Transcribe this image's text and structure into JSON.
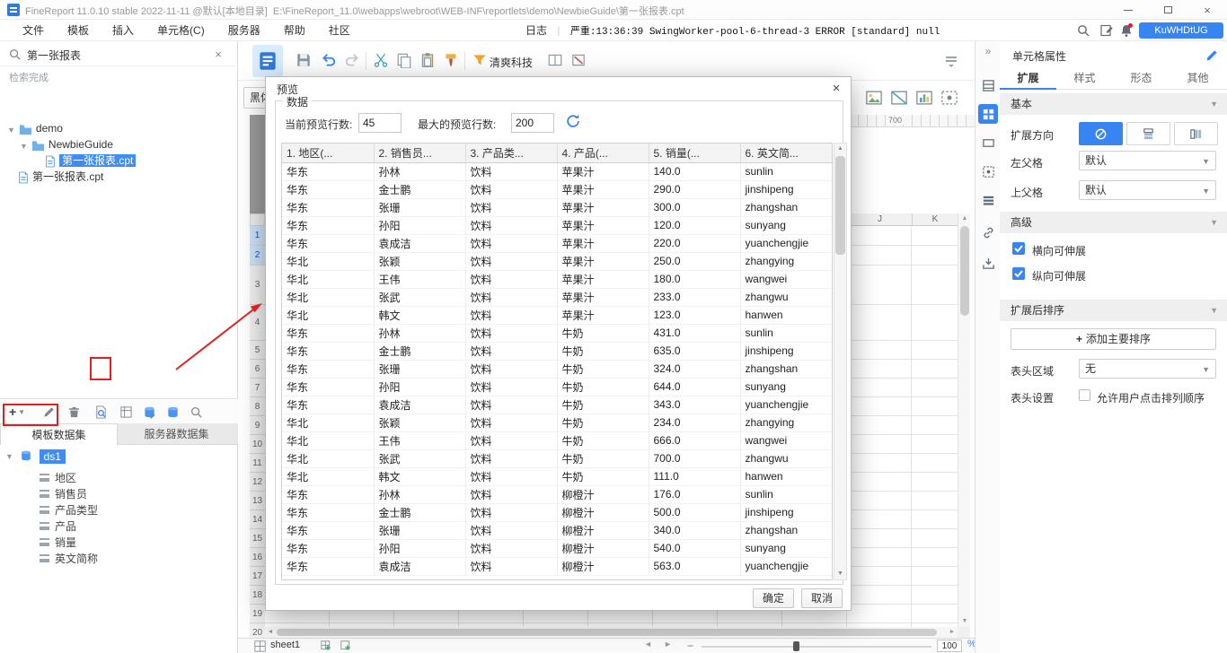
{
  "window": {
    "title": "FineReport 11.0.10 stable 2022-11-11 @默认[本地目录]",
    "path": "E:\\FineReport_11.0\\webapps\\webroot\\WEB-INF\\reportlets\\demo\\NewbieGuide\\第一张报表.cpt"
  },
  "menu": {
    "items": [
      "文件",
      "模板",
      "插入",
      "单元格(C)",
      "服务器",
      "帮助",
      "社区"
    ],
    "log_label": "日志",
    "log_text": "严重:13:36:39 SwingWorker-pool-6-thread-3 ERROR [standard] null",
    "account": "KuWHDtUG"
  },
  "toolbar": {
    "theme_name": "清爽科技",
    "font_name": "黑体"
  },
  "left": {
    "search_value": "第一张报表",
    "search_status": "检索完成",
    "tree": [
      {
        "label": "demo"
      },
      {
        "label": "NewbieGuide"
      },
      {
        "label": "第一张报表.cpt"
      },
      {
        "label": "第一张报表.cpt"
      }
    ],
    "tabs": [
      {
        "label": "模板数据集"
      },
      {
        "label": "服务器数据集"
      }
    ],
    "dataset_name": "ds1",
    "fields": [
      "地区",
      "销售员",
      "产品类型",
      "产品",
      "销量",
      "英文简称"
    ]
  },
  "canvas": {
    "ruler_mark": "700",
    "col_headers": [
      "J",
      "K"
    ],
    "rows": [
      {
        "n": "1",
        "h": 22,
        "selected": true
      },
      {
        "n": "2",
        "h": 22,
        "selected": true
      },
      {
        "n": "3",
        "h": 44
      },
      {
        "n": "4",
        "h": 40
      },
      {
        "n": "5",
        "h": 21
      },
      {
        "n": "6",
        "h": 21
      },
      {
        "n": "7",
        "h": 21
      },
      {
        "n": "8",
        "h": 21
      },
      {
        "n": "9",
        "h": 21
      },
      {
        "n": "10",
        "h": 21
      },
      {
        "n": "11",
        "h": 21
      },
      {
        "n": "12",
        "h": 21
      },
      {
        "n": "13",
        "h": 21
      },
      {
        "n": "14",
        "h": 21
      },
      {
        "n": "15",
        "h": 21
      },
      {
        "n": "16",
        "h": 21
      },
      {
        "n": "17",
        "h": 21
      },
      {
        "n": "18",
        "h": 21
      },
      {
        "n": "19",
        "h": 21
      },
      {
        "n": "20",
        "h": 21
      }
    ]
  },
  "sheet_bar": {
    "sheet_name": "sheet1",
    "zoom_value": "100",
    "zoom_unit": "%"
  },
  "dialog": {
    "title": "预览",
    "group_label": "数据",
    "current_rows_label": "当前预览行数:",
    "current_rows_value": "45",
    "max_rows_label": "最大的预览行数:",
    "max_rows_value": "200",
    "columns": [
      "1. 地区(...",
      "2. 销售员...",
      "3. 产品类...",
      "4. 产品(...",
      "5. 销量(...",
      "6. 英文简..."
    ],
    "rows": [
      [
        "华东",
        "孙林",
        "饮料",
        "苹果汁",
        "140.0",
        "sunlin"
      ],
      [
        "华东",
        "金士鹏",
        "饮料",
        "苹果汁",
        "290.0",
        "jinshipeng"
      ],
      [
        "华东",
        "张珊",
        "饮料",
        "苹果汁",
        "300.0",
        "zhangshan"
      ],
      [
        "华东",
        "孙阳",
        "饮料",
        "苹果汁",
        "120.0",
        "sunyang"
      ],
      [
        "华东",
        "袁成洁",
        "饮料",
        "苹果汁",
        "220.0",
        "yuanchengjie"
      ],
      [
        "华北",
        "张颖",
        "饮料",
        "苹果汁",
        "250.0",
        "zhangying"
      ],
      [
        "华北",
        "王伟",
        "饮料",
        "苹果汁",
        "180.0",
        "wangwei"
      ],
      [
        "华北",
        "张武",
        "饮料",
        "苹果汁",
        "233.0",
        "zhangwu"
      ],
      [
        "华北",
        "韩文",
        "饮料",
        "苹果汁",
        "123.0",
        "hanwen"
      ],
      [
        "华东",
        "孙林",
        "饮料",
        "牛奶",
        "431.0",
        "sunlin"
      ],
      [
        "华东",
        "金士鹏",
        "饮料",
        "牛奶",
        "635.0",
        "jinshipeng"
      ],
      [
        "华东",
        "张珊",
        "饮料",
        "牛奶",
        "324.0",
        "zhangshan"
      ],
      [
        "华东",
        "孙阳",
        "饮料",
        "牛奶",
        "644.0",
        "sunyang"
      ],
      [
        "华东",
        "袁成洁",
        "饮料",
        "牛奶",
        "343.0",
        "yuanchengjie"
      ],
      [
        "华北",
        "张颖",
        "饮料",
        "牛奶",
        "234.0",
        "zhangying"
      ],
      [
        "华北",
        "王伟",
        "饮料",
        "牛奶",
        "666.0",
        "wangwei"
      ],
      [
        "华北",
        "张武",
        "饮料",
        "牛奶",
        "700.0",
        "zhangwu"
      ],
      [
        "华北",
        "韩文",
        "饮料",
        "牛奶",
        "111.0",
        "hanwen"
      ],
      [
        "华东",
        "孙林",
        "饮料",
        "柳橙汁",
        "176.0",
        "sunlin"
      ],
      [
        "华东",
        "金士鹏",
        "饮料",
        "柳橙汁",
        "500.0",
        "jinshipeng"
      ],
      [
        "华东",
        "张珊",
        "饮料",
        "柳橙汁",
        "340.0",
        "zhangshan"
      ],
      [
        "华东",
        "孙阳",
        "饮料",
        "柳橙汁",
        "540.0",
        "sunyang"
      ],
      [
        "华东",
        "袁成洁",
        "饮料",
        "柳橙汁",
        "563.0",
        "yuanchengjie"
      ]
    ],
    "ok_label": "确定",
    "cancel_label": "取消"
  },
  "props": {
    "panel_title": "单元格属性",
    "tabs": [
      "扩展",
      "样式",
      "形态",
      "其他"
    ],
    "section_basic": "基本",
    "expand_dir_label": "扩展方向",
    "left_parent_label": "左父格",
    "left_parent_value": "默认",
    "top_parent_label": "上父格",
    "top_parent_value": "默认",
    "section_advanced": "高级",
    "h_expand_label": "横向可伸展",
    "v_expand_label": "纵向可伸展",
    "section_sort": "扩展后排序",
    "add_sort_label": "添加主要排序",
    "header_area_label": "表头区域",
    "header_area_value": "无",
    "header_set_label": "表头设置",
    "header_set_option": "允许用户点击排列顺序"
  }
}
